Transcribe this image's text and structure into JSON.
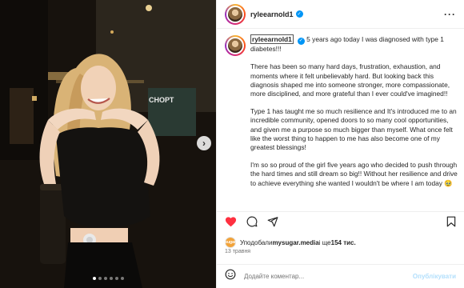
{
  "post": {
    "username": "ryleearnold1",
    "caption_username": "ryleearnold1",
    "caption_paragraphs": [
      "5 years ago today I was diagnosed with type 1 diabetes!!!",
      "There has been so many hard days, frustration, exhaustion, and moments where it felt unbelievably hard. But looking back this diagnosis shaped me into someone stronger, more compassionate, more disciplined, and more grateful than I ever could've imagined!!",
      "Type 1 has taught me so much resilience and It's introduced me to an incredible community, opened doors to so many cool opportunities, and given me a purpose so much bigger than myself. What once felt like the worst thing to happen to me has also become one of my greatest blessings!",
      "I'm so so proud of the girl five years ago who decided to push through the hard times and still dream so big!! Without her resilience and drive to achieve everything she wanted I wouldn't be where I am today 🥹"
    ],
    "likes_prefix": "Уподобали ",
    "likes_user": "mysugar.media",
    "likes_and": " і ще ",
    "likes_count": "154 тис.",
    "date": "13 травня",
    "liker_avatar_label": "sugar"
  },
  "comment": {
    "placeholder": "Додайте коментар...",
    "post_label": "Опублікувати"
  },
  "photo": {
    "store_sign": "СНОРТ",
    "carousel_total": 6,
    "carousel_active": 1
  },
  "icons": {
    "more": "more-icon",
    "like": "heart-icon",
    "comment": "comment-icon",
    "share": "share-icon",
    "save": "bookmark-icon",
    "emoji": "emoji-icon",
    "next": "chevron-right-icon"
  },
  "colors": {
    "like_red": "#ff3040",
    "verified_blue": "#0095f6",
    "post_button_disabled": "#b2dffc"
  }
}
